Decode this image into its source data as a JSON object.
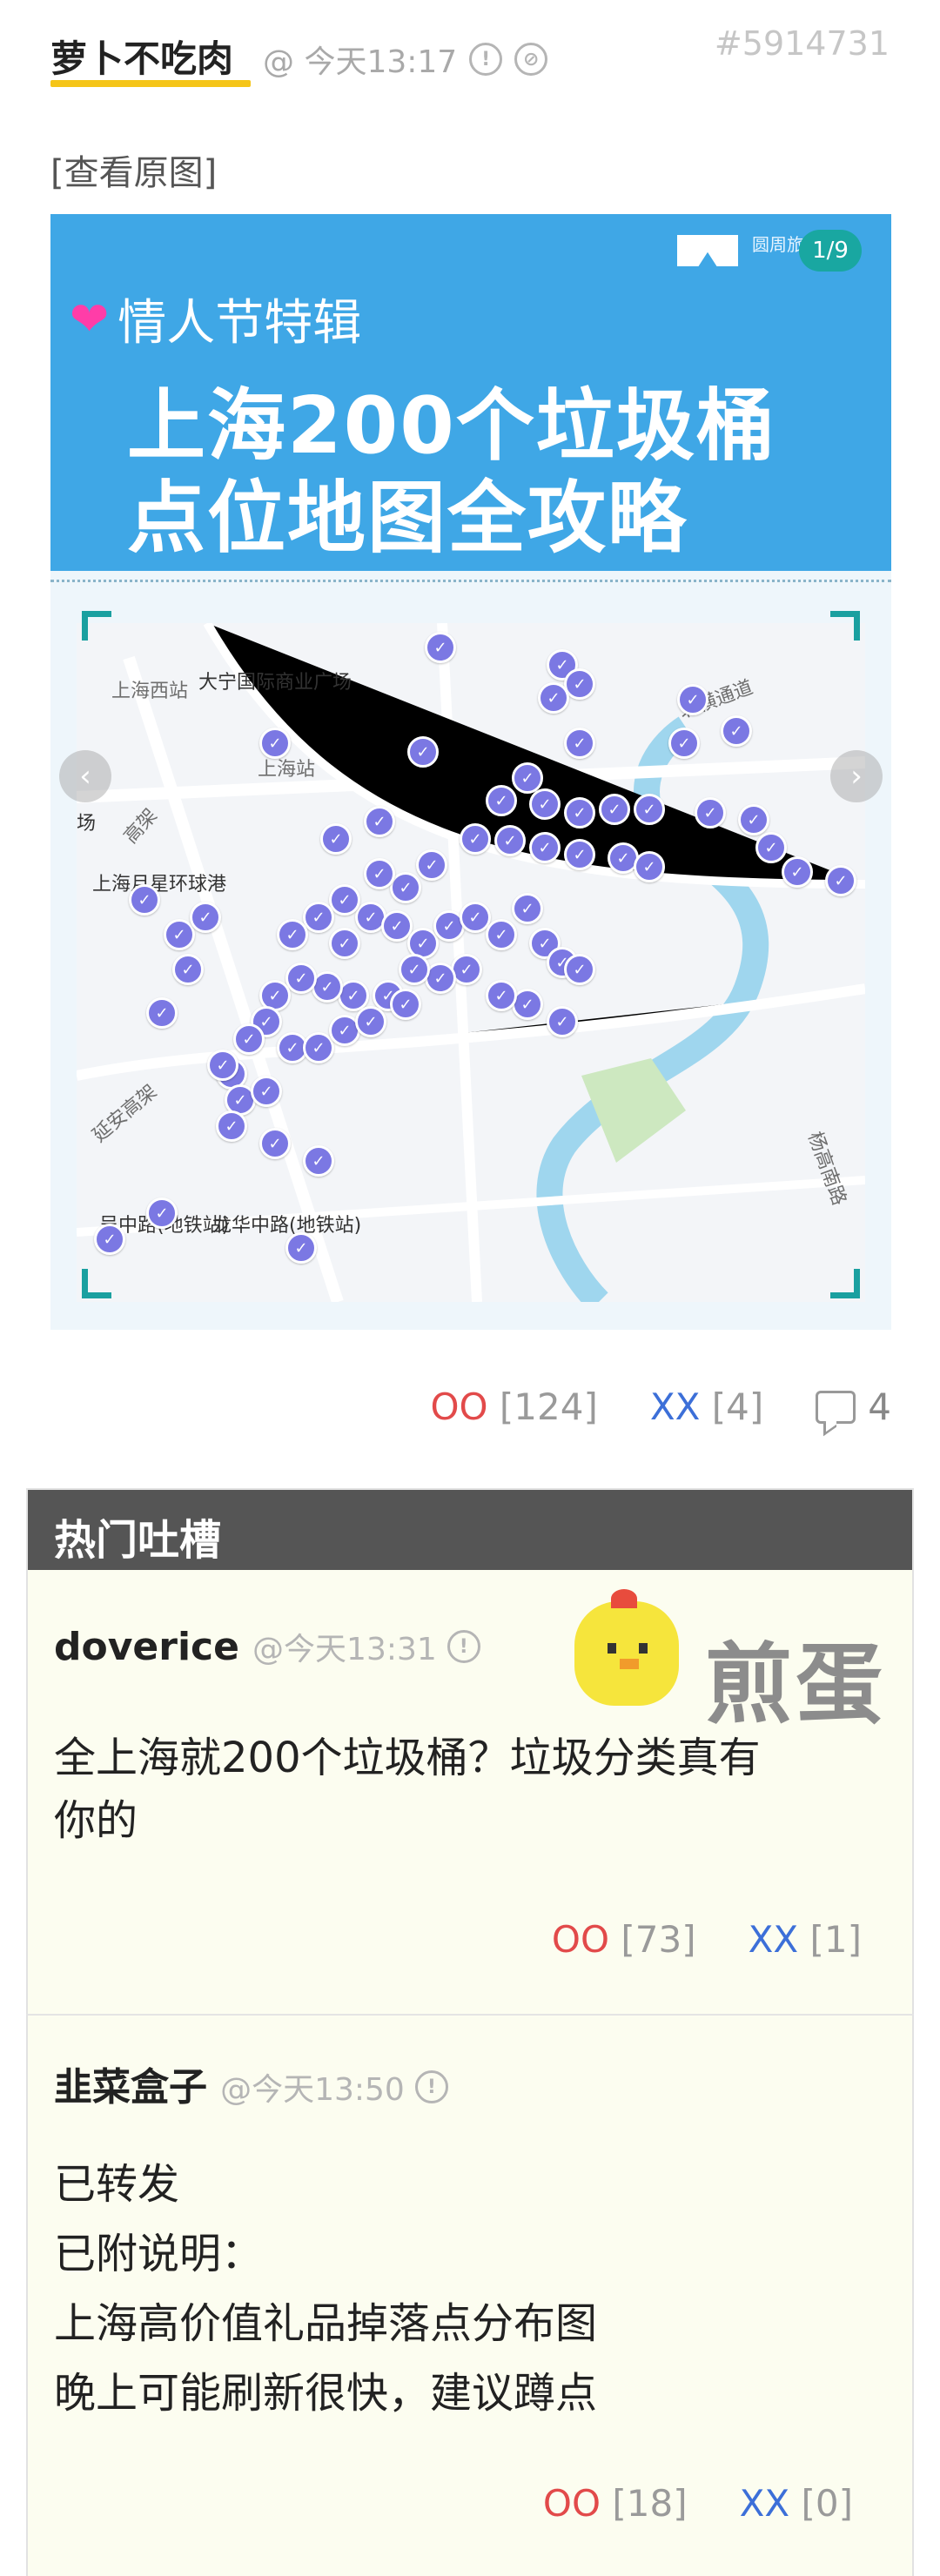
{
  "post": {
    "author": "萝卜不吃肉",
    "time": "@ 今天13:17",
    "id": "#5914731",
    "view_original": "[查看原图]",
    "oo_label": "OO",
    "oo_count": "[124]",
    "xx_label": "XX",
    "xx_count": "[4]",
    "comment_count": "4"
  },
  "image": {
    "page_indicator": "1/9",
    "brand": "圆周旅迹",
    "subtitle": "情人节特辑",
    "title_line1": "上海200个垃圾桶",
    "title_line2": "点位地图全攻略",
    "map_labels": {
      "west_station": "上海西站",
      "daning_plaza": "大宁国际商业广场",
      "shanghai_station": "上海站",
      "field_partial": "场",
      "moonstar_mall": "上海月星环球港",
      "wuzhong_rd": "吴中路(地铁站)",
      "longhua_rd": "龙华中路(地铁站)",
      "gaojia": "高架",
      "beiheng": "北横通道",
      "yanjiang": "延安高架",
      "yangpu": "杨高南路"
    },
    "pin_icon": "check-pin-icon"
  },
  "hot": {
    "title": "热门吐槽",
    "watermark": "煎蛋",
    "comments": [
      {
        "author": "doverice",
        "time": "@今天13:31",
        "lines": [
          "全上海就200个垃圾桶？垃圾分类真有",
          "你的"
        ],
        "oo_label": "OO",
        "oo_count": "[73]",
        "xx_label": "XX",
        "xx_count": "[1]"
      },
      {
        "author": "韭菜盒子",
        "time": "@今天13:50",
        "lines": [
          "已转发",
          "已附说明：",
          "上海高价值礼品掉落点分布图",
          "晚上可能刷新很快，建议蹲点"
        ],
        "oo_label": "OO",
        "oo_count": "[18]",
        "xx_label": "XX",
        "xx_count": "[0]"
      }
    ]
  },
  "colors": {
    "accent_underline": "#f5c518",
    "oo": "#e24a4a",
    "xx": "#3c6fd8",
    "banner": "#3fa7e6",
    "pin": "#7b78e3",
    "hot_header": "#555555"
  }
}
